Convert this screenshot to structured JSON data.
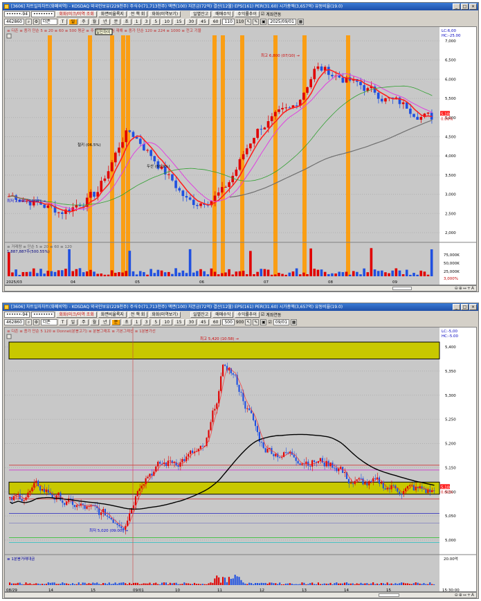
{
  "top": {
    "title": "[3606] 차트일자차트(화폐비역) - KOSDAQ 외국인보유(229천주) 주식수(71,713천주) 액면(100) 자본금(72억) 결산(12월) EPS(161) PER(31.60) 시가총액(3,657억) 유동비율(19.0)",
    "code": "462860",
    "stock_name": "더존",
    "toolbar_buttons": [
      "회화(미크/미역 조회",
      "화면비율록지",
      "전 책 회",
      "화화(미역보기)",
      "일별잔고",
      "매매수익",
      "수익률추이",
      "계좌연동"
    ],
    "period_buttons": [
      "T",
      "일",
      "주",
      "월",
      "년",
      "분",
      "초",
      "틱"
    ],
    "interval_buttons": [
      "1",
      "3",
      "5",
      "10",
      "15",
      "30",
      "45",
      "60"
    ],
    "count": "110",
    "count_total": "110",
    "date": "2025/09/01",
    "tooltip": "일진하여",
    "legend_main": "≡ 다존 ≡ 종가 단순 5 ≡ 20 ≡ 60 ≡ 500 평균 ≡ 주 재해 ≡ 세심 재해 ≡ 종가 단순 120 ≡ 224 ≡ 1000 ≡ 전고 기물",
    "legend_volume": "≡ 거래량 ≡ 단순 5 ≡ 20 ≡ 60 ≡ 120",
    "volume_readout": "1,887,887주(500.55%)",
    "annot_high": "최고 6,800 (07/10) →",
    "annot_low": "최저 2,066 (04/07) →",
    "annot_mid1": "철키 (06.5%)",
    "annot_mid2": "두산 (60.9%)",
    "price_axis": [
      "7,000",
      "6,500",
      "6,000",
      "5,500",
      "5,000",
      "4,500",
      "4,000",
      "3,500",
      "3,000",
      "2,500",
      "2,000"
    ],
    "price_label_top": "LC:6,00",
    "price_label_top2": "HC:-25.00",
    "last_price": "5,100",
    "last_pct": "0.00%",
    "vol_axis": [
      "75,000K",
      "50,000K",
      "25,000K"
    ],
    "vol_last": "3,000%",
    "date_axis": [
      "2025/03",
      "04",
      "05",
      "06",
      "07",
      "08",
      "09"
    ]
  },
  "bottom": {
    "title": "[3606] 차트일자차트(화폐비역) - KOSDAQ 외국인보유(229천주) 주식수(71,713천주) 액면(100) 자본금(72억) 결산(12월) EPS(161) PER(31.60) 시가총액(3,657억) 유동비율(19.0)",
    "code": "462860",
    "stock_name": "더존",
    "toolbar_buttons": [
      "회화(미크/미역 조회",
      "화면비율록지",
      "전 책 회",
      "화화(미역보기)",
      "일별잔고",
      "매매수익",
      "수익률추이",
      "계좌연동"
    ],
    "period_buttons": [
      "T",
      "일",
      "주",
      "월",
      "년",
      "분",
      "초",
      "틱"
    ],
    "interval_buttons": [
      "1",
      "3",
      "5",
      "10",
      "15",
      "30",
      "45",
      "60"
    ],
    "count": "500",
    "count_total": "900",
    "date": "09/01",
    "legend_main": "≡ 다존 ≡ 종가 단순 5 120 ≡ Donnel(분봉고기) ≡ 분봉그래프 ≡ 기본그래선 ≡ 1분봉가선",
    "legend_volume": "≡ 1분봉거래대금",
    "annot_high": "최고 5,420 (10:58) →",
    "annot_low": "최저 5,020 (09:00) →",
    "price_axis": [
      "5,400",
      "5,350",
      "5,300",
      "5,250",
      "5,200",
      "5,150",
      "5,100",
      "5,050",
      "5,000"
    ],
    "price_label_top": "LC:-5,00",
    "price_label_top2": "HC:-5.00",
    "last_price": "5,100",
    "last_pct": "0.00%",
    "vol_axis": [
      "20.00억"
    ],
    "vol_last": "15:30:00",
    "date_axis": [
      "08/29",
      "14",
      "15",
      "09/01",
      "10",
      "11",
      "12",
      "13",
      "14",
      "15"
    ]
  },
  "colors": {
    "up": "#e00000",
    "down": "#2050e0",
    "signal_bar": "#ff9900",
    "ma_short": "#ff2020",
    "ma_mid": "#e040e0",
    "ma_long": "#30a030",
    "ma_120": "#707070",
    "band": "#c8c800",
    "chart_bg": "#c8c8c8"
  }
}
